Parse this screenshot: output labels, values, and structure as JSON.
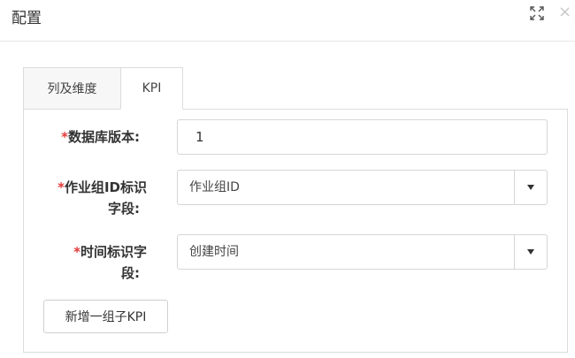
{
  "dialog": {
    "title": "配置"
  },
  "tabs": [
    {
      "label": "列及维度",
      "active": false
    },
    {
      "label": "KPI",
      "active": true
    }
  ],
  "form": {
    "required_mark": "*",
    "db_version": {
      "label": "数据库版本:",
      "value": "1"
    },
    "group_id_field": {
      "label_line1": "作业组ID标识",
      "label_line2": "字段:",
      "value": "作业组ID"
    },
    "time_field": {
      "label_line1": "时间标识字",
      "label_line2": "段:",
      "value": "创建时间"
    }
  },
  "actions": {
    "add_group_label": "新增一组子KPI"
  },
  "icons": {
    "maximize": "maximize-icon",
    "close": "close-icon",
    "dropdown": "caret-down-icon"
  },
  "colors": {
    "required": "#e03a3a",
    "border": "#dcdcdc"
  }
}
